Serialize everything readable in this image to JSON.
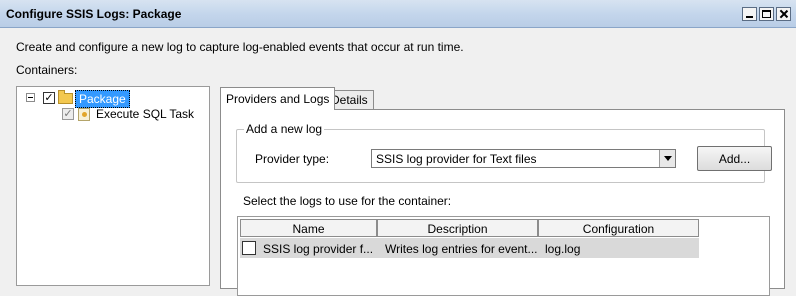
{
  "window": {
    "title": "Configure SSIS Logs: Package"
  },
  "description": "Create and configure a new log to capture log-enabled events that occur at run time.",
  "containers_label": "Containers:",
  "tree": {
    "package": {
      "label": "Package",
      "checked": true,
      "check_glyph": "✓"
    },
    "sql_task": {
      "label": "Execute SQL Task",
      "checked": true,
      "check_glyph": "✓"
    }
  },
  "tabs": [
    {
      "label": "Providers and Logs",
      "active": true
    },
    {
      "label": "Details",
      "active": false
    }
  ],
  "add_log": {
    "group_title": "Add a new log",
    "provider_label": "Provider type:",
    "provider_value": "SSIS log provider for Text files",
    "add_button": "Add..."
  },
  "logs": {
    "label": "Select the logs to use for the container:",
    "columns": [
      "Name",
      "Description",
      "Configuration"
    ],
    "rows": [
      {
        "checked": false,
        "name": "SSIS log provider f...",
        "description": "Writes log entries for event...",
        "configuration": "log.log"
      }
    ]
  },
  "colors": {
    "selection": "#3399ff",
    "titlebar": "#c4d6ec"
  }
}
